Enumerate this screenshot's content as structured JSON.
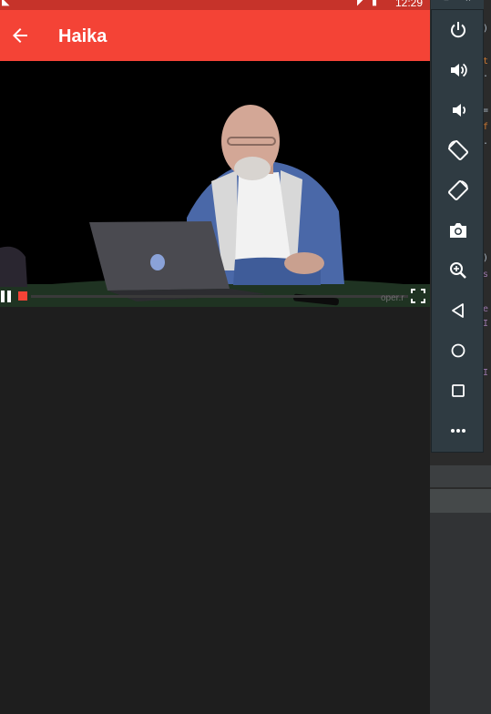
{
  "status_bar": {
    "time": "12:29"
  },
  "app_bar": {
    "title": "Haika"
  },
  "video": {
    "watermark": "oper.r"
  },
  "emulator": {
    "top_minimize": "=",
    "top_close": "×",
    "buttons": [
      "power",
      "volume-up",
      "volume-down",
      "rotate-left",
      "rotate-right",
      "screenshot",
      "zoom",
      "back",
      "home",
      "overview",
      "more"
    ]
  },
  "ide": {
    "code_chars": [
      ")",
      "t",
      ".",
      "=",
      "f",
      ".",
      ")",
      "s",
      "e",
      "I",
      "I"
    ]
  }
}
